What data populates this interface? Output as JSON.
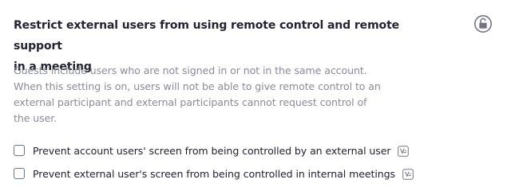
{
  "setting": {
    "title_line1": "Restrict external users from using remote control and remote support",
    "title_line2": "in a meeting",
    "description_lines": [
      "Guests include users who are not signed in or not in the same account.",
      "When this setting is on, users will not be able to give remote control to an",
      "external participant and external participants cannot request control of",
      "the user."
    ],
    "lock_icon": "unlocked-padlock-icon",
    "options": [
      {
        "label": "Prevent account users' screen from being controlled by an external user",
        "checked": false,
        "info_icon": "version-info-icon"
      },
      {
        "label": "Prevent external user's screen from being controlled in internal meetings",
        "checked": false,
        "info_icon": "version-info-icon"
      }
    ]
  },
  "colors": {
    "title": "#232333",
    "description": "#8b8b99",
    "icon": "#747487"
  }
}
